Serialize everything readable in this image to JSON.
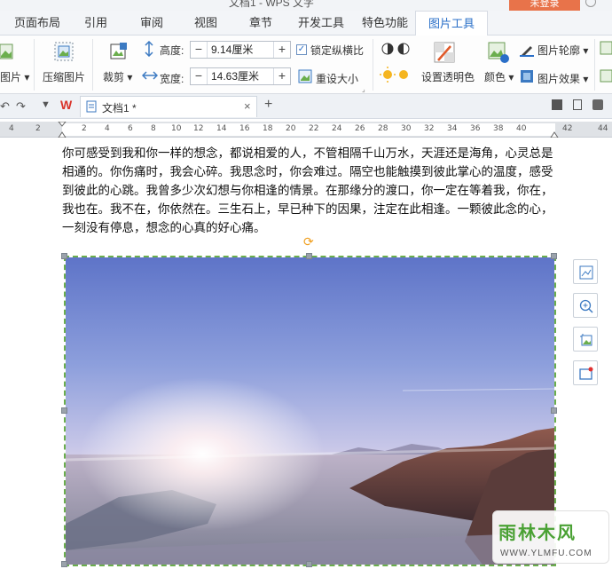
{
  "window": {
    "title": "文档1 - WPS 文字",
    "login_label": "未登录",
    "help_icon": "help-icon"
  },
  "tabs": [
    {
      "label": "页面布局"
    },
    {
      "label": "引用"
    },
    {
      "label": "审阅"
    },
    {
      "label": "视图"
    },
    {
      "label": "章节"
    },
    {
      "label": "开发工具"
    },
    {
      "label": "特色功能"
    },
    {
      "label": "图片工具",
      "active": true
    }
  ],
  "ribbon": {
    "insert_picture_label": "图片",
    "compress_label": "压缩图片",
    "crop_label": "裁剪",
    "height_label": "高度:",
    "height_value": "9.14厘米",
    "width_label": "宽度:",
    "width_value": "14.63厘米",
    "lock_ratio_label": "锁定纵横比",
    "lock_ratio_checked": true,
    "reset_size_label": "重设大小",
    "set_transparent_label": "设置透明色",
    "color_label": "颜色",
    "outline_label": "图片轮廓",
    "effect_label": "图片效果"
  },
  "docbar": {
    "doc_name": "文档1 *",
    "new_tab_symbol": "+",
    "close_symbol": "×"
  },
  "ruler": {
    "labels": [
      "4",
      "2",
      "",
      "2",
      "4",
      "6",
      "8",
      "10",
      "12",
      "14",
      "16",
      "18",
      "20",
      "22",
      "24",
      "26",
      "28",
      "30",
      "32",
      "34",
      "36",
      "38",
      "40",
      "42",
      "44"
    ]
  },
  "document": {
    "paragraph": "你可感受到我和你一样的想念，都说相爱的人，不管相隔千山万水，天涯还是海角，心灵总是相通的。你伤痛时，我会心碎。我思念时，你会难过。隔空也能触摸到彼此掌心的温度，感受到彼此的心跳。我曾多少次幻想与你相逢的情景。在那缘分的渡口，你一定在等着我，你在，我也在。我不在，你依然在。三生石上，早已种下的因果，注定在此相逢。一颗彼此念的心，一刻没有停息，想念的心真的好心痛。"
  },
  "watermark": {
    "title": "雨林木风",
    "url": "WWW.YLMFU.COM"
  },
  "colors": {
    "accent": "#2a6fc8",
    "selection_border": "#6bae4d",
    "login_bg": "#e8734a"
  }
}
